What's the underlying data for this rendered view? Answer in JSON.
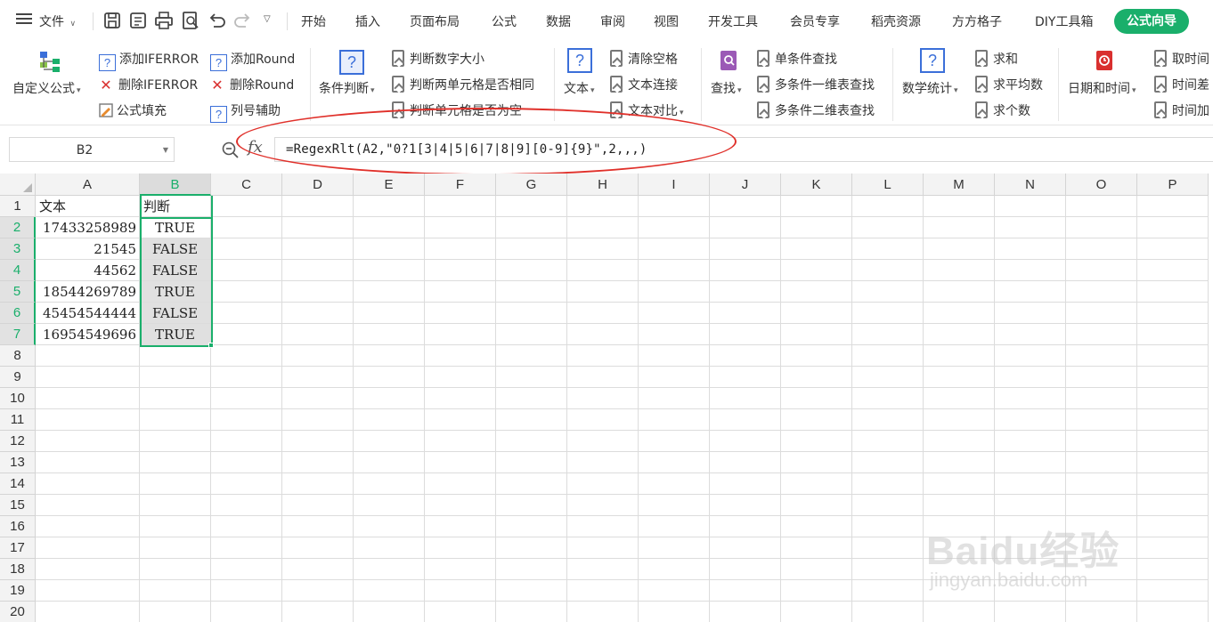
{
  "menubar": {
    "file_label": "文件",
    "tabs": [
      "开始",
      "插入",
      "页面布局",
      "公式",
      "数据",
      "审阅",
      "视图",
      "开发工具",
      "会员专享",
      "稻壳资源",
      "方方格子",
      "DIY工具箱"
    ],
    "active_tab": "公式向导"
  },
  "ribbon": {
    "custom_formula": "自定义公式",
    "add_iferror": "添加IFERROR",
    "del_iferror": "删除IFERROR",
    "formula_fill": "公式填充",
    "add_round": "添加Round",
    "del_round": "删除Round",
    "col_helper": "列号辅助",
    "cond_judge": "条件判断",
    "judge_num_size": "判断数字大小",
    "judge_two_cells": "判断两单元格是否相同",
    "judge_cell_empty": "判断单元格是否为空",
    "text": "文本",
    "clear_spaces": "清除空格",
    "text_concat": "文本连接",
    "text_compare": "文本对比",
    "find": "查找",
    "single_lookup": "单条件查找",
    "multi_1d_lookup": "多条件一维表查找",
    "multi_2d_lookup": "多条件二维表查找",
    "math_stats": "数学统计",
    "sum": "求和",
    "average": "求平均数",
    "count": "求个数",
    "date_time": "日期和时间",
    "take_time": "取时间",
    "time_diff": "时间差",
    "time_add": "时间加"
  },
  "formula_bar": {
    "name_box": "B2",
    "fx": "fx",
    "formula": "=RegexRlt(A2,\"0?1[3|4|5|6|7|8|9][0-9]{9}\",2,,,)"
  },
  "grid": {
    "columns": [
      "A",
      "B",
      "C",
      "D",
      "E",
      "F",
      "G",
      "H",
      "I",
      "J",
      "K",
      "L",
      "M",
      "N",
      "O",
      "P"
    ],
    "rows": [
      "1",
      "2",
      "3",
      "4",
      "5",
      "6",
      "7",
      "8",
      "9",
      "10",
      "11",
      "12",
      "13",
      "14",
      "15",
      "16",
      "17",
      "18",
      "19",
      "20"
    ],
    "header_row": {
      "a": "文本",
      "b": "判断"
    },
    "data": [
      {
        "a": "17433258989",
        "b": "TRUE"
      },
      {
        "a": "21545",
        "b": "FALSE"
      },
      {
        "a": "44562",
        "b": "FALSE"
      },
      {
        "a": "18544269789",
        "b": "TRUE"
      },
      {
        "a": "45454544444",
        "b": "FALSE"
      },
      {
        "a": "16954549696",
        "b": "TRUE"
      }
    ]
  },
  "watermark": {
    "brand": "Baidu经验",
    "url": "jingyan.baidu.com"
  },
  "colors": {
    "accent": "#1aaf6b",
    "annotation": "#e0302a",
    "icon_blue": "#3b6fd9"
  }
}
